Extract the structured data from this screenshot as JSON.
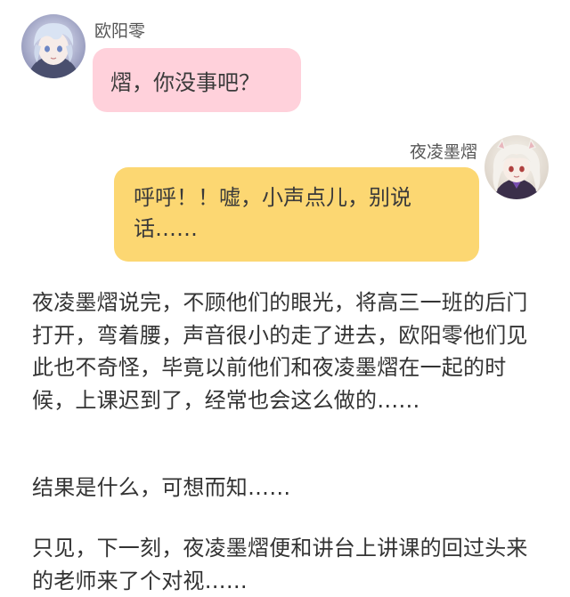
{
  "messages": [
    {
      "sender": "欧阳零",
      "text": "熠，你没事吧？",
      "avatar": "silver-haired-boy-avatar",
      "bubble_color": "#ffd1db",
      "side": "left"
    },
    {
      "sender": "夜凌墨熠",
      "text": "呼呼！！嘘，小声点儿，别说话……",
      "avatar": "white-haired-girl-avatar",
      "bubble_color": "#fcd772",
      "side": "right"
    }
  ],
  "narration": [
    "夜凌墨熠说完，不顾他们的眼光，将高三一班的后门打开，弯着腰，声音很小的走了进去，欧阳零他们见此也不奇怪，毕竟以前他们和夜凌墨熠在一起的时候，上课迟到了，经常也会这么做的……",
    "结果是什么，可想而知……",
    "只见，下一刻，夜凌墨熠便和讲台上讲课的回过头来的老师来了个对视……"
  ]
}
